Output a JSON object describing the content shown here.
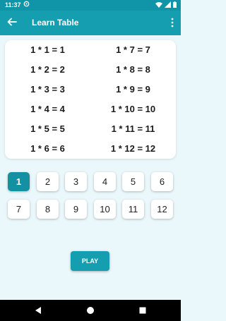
{
  "status": {
    "time": "11:37"
  },
  "appbar": {
    "title": "Learn Table"
  },
  "equations": [
    "1 * 1 = 1",
    "1 * 2 = 2",
    "1 * 3 = 3",
    "1 * 4 = 4",
    "1 * 5 = 5",
    "1 * 6 = 6",
    "1 * 7 = 7",
    "1 * 8 = 8",
    "1 * 9 = 9",
    "1 * 10 = 10",
    "1 * 11 = 11",
    "1 * 12 = 12"
  ],
  "numbers": [
    "1",
    "2",
    "3",
    "4",
    "5",
    "6",
    "7",
    "8",
    "9",
    "10",
    "11",
    "12"
  ],
  "selected_number": "1",
  "play_label": "PLAY",
  "colors": {
    "accent": "#159eb0",
    "background": "#eaf7fb",
    "selected": "#1490a3"
  }
}
